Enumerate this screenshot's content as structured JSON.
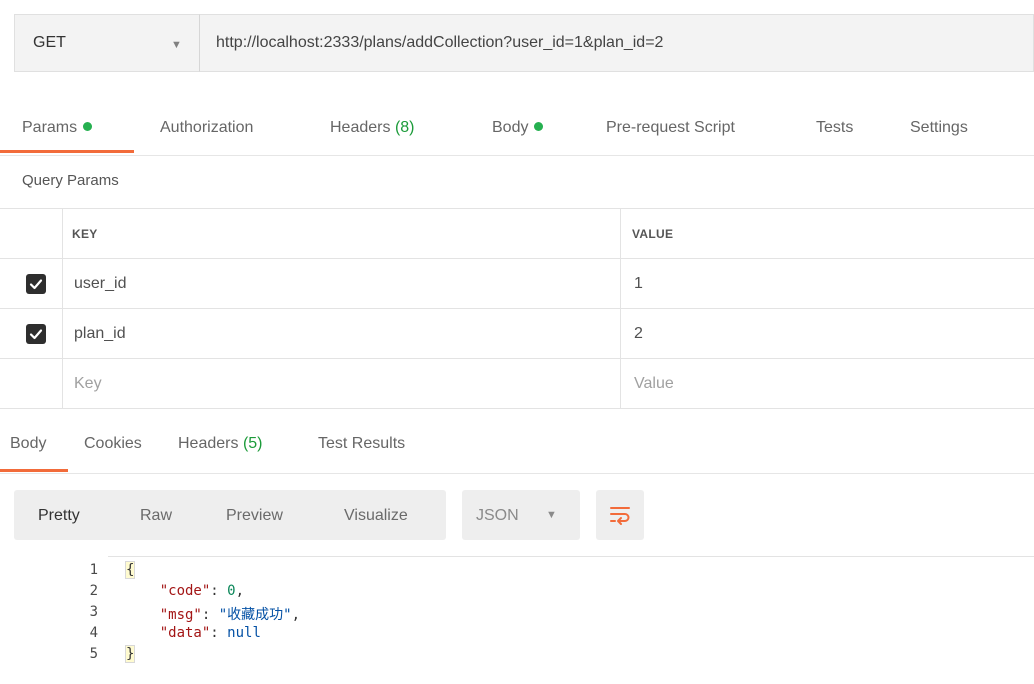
{
  "request": {
    "method": "GET",
    "url": "http://localhost:2333/plans/addCollection?user_id=1&plan_id=2"
  },
  "request_tabs": [
    {
      "label": "Params",
      "dot": true
    },
    {
      "label": "Authorization"
    },
    {
      "label": "Headers",
      "count": "(8)"
    },
    {
      "label": "Body",
      "dot": true
    },
    {
      "label": "Pre-request Script"
    },
    {
      "label": "Tests"
    },
    {
      "label": "Settings"
    }
  ],
  "active_request_tab": "Params",
  "query_params": {
    "title": "Query Params",
    "headers": {
      "key": "KEY",
      "value": "VALUE"
    },
    "rows": [
      {
        "checked": true,
        "key": "user_id",
        "value": "1"
      },
      {
        "checked": true,
        "key": "plan_id",
        "value": "2"
      }
    ],
    "placeholder": {
      "key": "Key",
      "value": "Value"
    }
  },
  "response_tabs": [
    {
      "label": "Body"
    },
    {
      "label": "Cookies"
    },
    {
      "label": "Headers",
      "count": "(5)"
    },
    {
      "label": "Test Results"
    }
  ],
  "active_response_tab": "Body",
  "view_modes": [
    "Pretty",
    "Raw",
    "Preview",
    "Visualize"
  ],
  "active_view_mode": "Pretty",
  "format": "JSON",
  "code": {
    "line_numbers": [
      "1",
      "2",
      "3",
      "4",
      "5"
    ],
    "open_brace": "{",
    "close_brace": "}",
    "code_key": "\"code\"",
    "code_val": "0",
    "msg_key": "\"msg\"",
    "msg_val": "\"收藏成功\"",
    "data_key": "\"data\"",
    "data_val": "null"
  },
  "colors": {
    "accent": "#f26b3a",
    "status_dot": "#26b050",
    "count": "#1c9b3a"
  }
}
